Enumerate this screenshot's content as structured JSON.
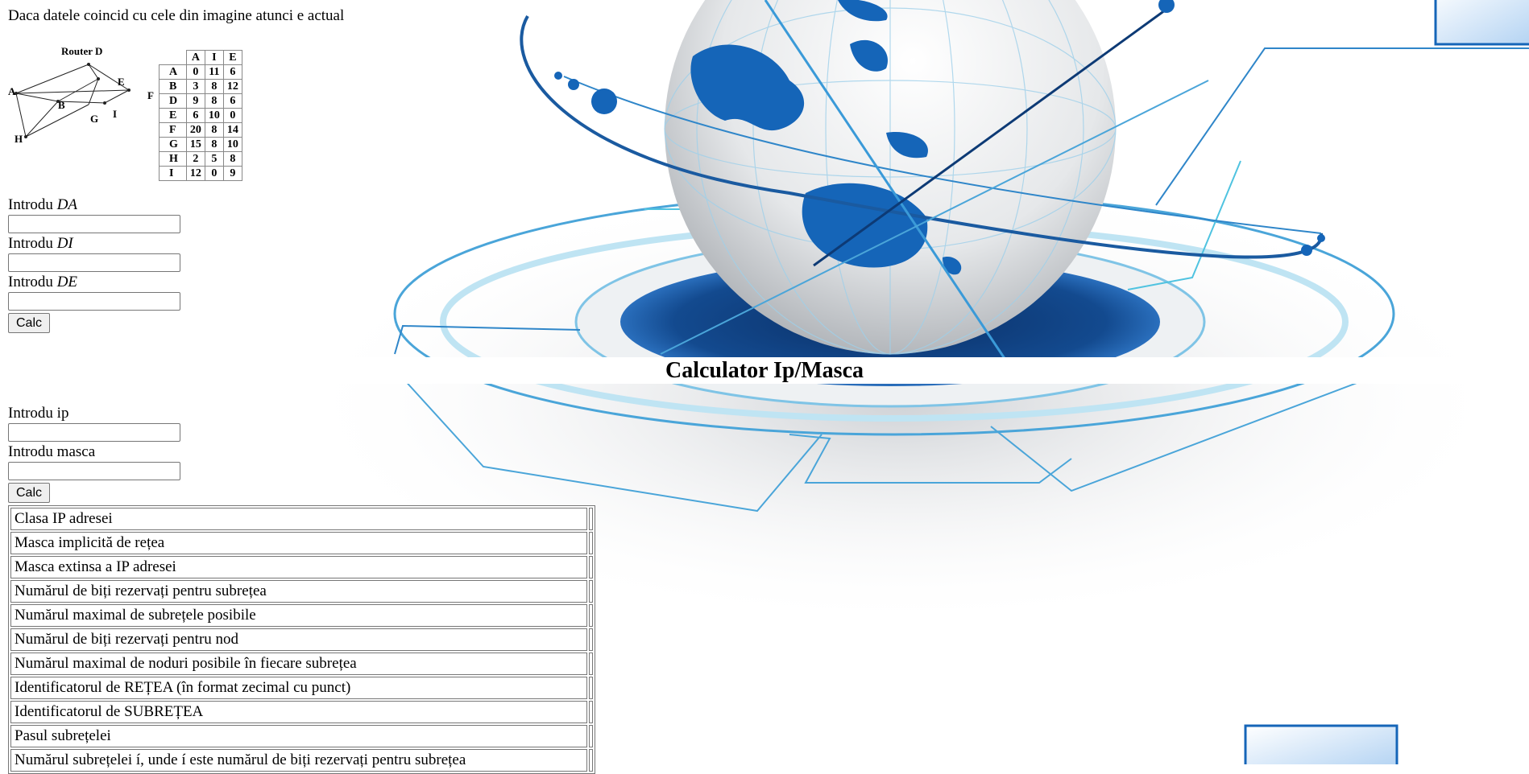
{
  "top_note": "Daca datele coincid cu cele din imagine atunci e actual",
  "topology": {
    "router_title": "Router D",
    "nodes": [
      "A",
      "B",
      "E",
      "F",
      "G",
      "H",
      "I"
    ]
  },
  "distance_table": {
    "columns": [
      "A",
      "I",
      "E"
    ],
    "rows": [
      {
        "node": "A",
        "values": [
          "0",
          "11",
          "6"
        ]
      },
      {
        "node": "B",
        "values": [
          "3",
          "8",
          "12"
        ]
      },
      {
        "node": "D",
        "values": [
          "9",
          "8",
          "6"
        ]
      },
      {
        "node": "E",
        "values": [
          "6",
          "10",
          "0"
        ]
      },
      {
        "node": "F",
        "values": [
          "20",
          "8",
          "14"
        ]
      },
      {
        "node": "G",
        "values": [
          "15",
          "8",
          "10"
        ]
      },
      {
        "node": "H",
        "values": [
          "2",
          "5",
          "8"
        ]
      },
      {
        "node": "I",
        "values": [
          "12",
          "0",
          "9"
        ]
      }
    ]
  },
  "router_form": {
    "fields": [
      {
        "prefix": "Introdu ",
        "var": "DA",
        "value": ""
      },
      {
        "prefix": "Introdu ",
        "var": "DI",
        "value": ""
      },
      {
        "prefix": "Introdu ",
        "var": "DE",
        "value": ""
      }
    ],
    "button": "Calc"
  },
  "calculator": {
    "title": "Calculator Ip/Masca",
    "fields": [
      {
        "label": "Introdu ip",
        "value": ""
      },
      {
        "label": "Introdu masca",
        "value": ""
      }
    ],
    "button": "Calc",
    "results": [
      "Clasa IP adresei",
      "Masca implicită de rețea",
      "Masca extinsa a IP adresei",
      "Numărul de biți rezervați pentru subrețea",
      "Numărul maximal de subrețele posibile",
      "Numărul de biți rezervați pentru nod",
      "Numărul maximal de noduri posibile în fiecare subrețea",
      "Identificatorul de REȚEA (în format zecimal cu punct)",
      "Identificatorul de SUBREȚEA",
      "Pasul subrețelei",
      "Numărul subrețelei í, unde í este numărul de biți rezervați pentru subrețea"
    ]
  },
  "colors": {
    "globe_blue": "#1565b8",
    "orbit_blue": "#2f86c9",
    "cyan_line": "#4fc3e0"
  }
}
